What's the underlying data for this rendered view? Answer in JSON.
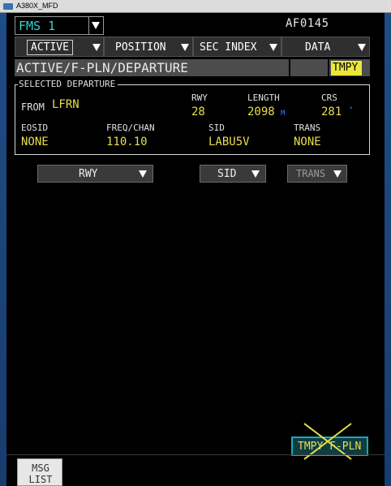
{
  "window": {
    "title": "A380X_MFD"
  },
  "header": {
    "fms_selector": "FMS 1",
    "flight_number": "AF0145"
  },
  "menu": {
    "items": [
      {
        "label": "ACTIVE"
      },
      {
        "label": "POSITION"
      },
      {
        "label": "SEC INDEX"
      },
      {
        "label": "DATA"
      }
    ]
  },
  "page": {
    "title": "ACTIVE/F-PLN/DEPARTURE",
    "tmpy_tag": "TMPY"
  },
  "selected_departure": {
    "section_title": "SELECTED DEPARTURE",
    "from_label": "FROM",
    "from_value": "LFRN",
    "rwy_label": "RWY",
    "rwy_value": "28",
    "length_label": "LENGTH",
    "length_value": "2098",
    "length_unit": "M",
    "crs_label": "CRS",
    "crs_value": "281",
    "crs_unit": "°",
    "eosid_label": "EOSID",
    "eosid_value": "NONE",
    "freq_label": "FREQ/CHAN",
    "freq_value": "110.10",
    "sid_label": "SID",
    "sid_value": "LABU5V",
    "trans_label": "TRANS",
    "trans_value": "NONE"
  },
  "dropdowns": {
    "rwy": "RWY",
    "sid": "SID",
    "trans": "TRANS"
  },
  "buttons": {
    "tmpy_fpln": "TMPY F-PLN",
    "msg_list_line1": "MSG",
    "msg_list_line2": "LIST"
  },
  "colors": {
    "cyan": "#2fd4d4",
    "amber": "#e8df4a",
    "tmpy_yellow": "#ece83a",
    "button_cyan": "#1aa9b8"
  }
}
